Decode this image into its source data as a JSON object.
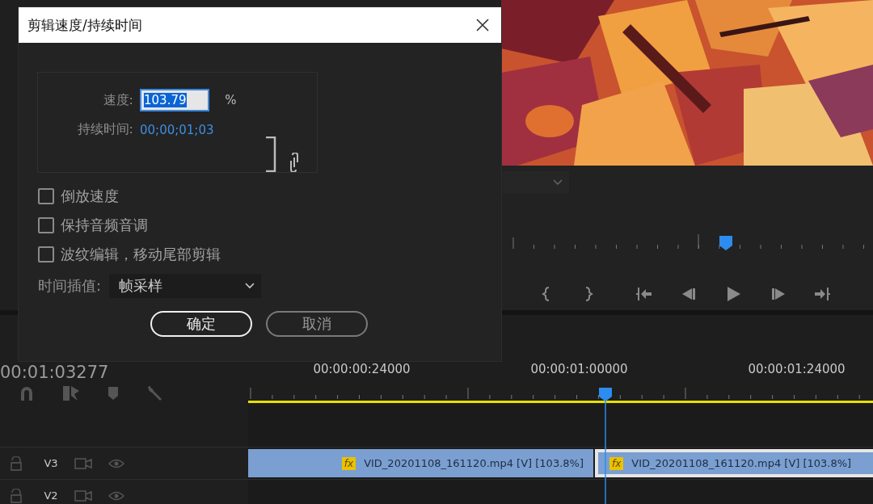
{
  "dialog": {
    "title": "剪辑速度/持续时间",
    "speed": {
      "label": "速度:",
      "value": "103.79",
      "unit": "%"
    },
    "duration": {
      "label": "持续时间:",
      "value": "00;00;01;03"
    },
    "options": [
      {
        "label": "倒放速度",
        "checked": false
      },
      {
        "label": "保持音频音调",
        "checked": false
      },
      {
        "label": "波纹编辑，移动尾部剪辑",
        "checked": false
      }
    ],
    "interpolation": {
      "label": "时间插值:",
      "value": "帧采样"
    },
    "buttons": [
      {
        "label": "确定",
        "focused": true
      },
      {
        "label": "取消",
        "focused": false
      }
    ]
  },
  "timeline": {
    "timecode": "00:01:03277",
    "ruler_labels": [
      "00:00:00:24000",
      "00:00:01:00000",
      "00:00:01:24000"
    ],
    "tracks": [
      {
        "name": "V3",
        "clips": [
          {
            "fx": "fx",
            "name": "VID_20201108_161120.mp4 [V] [103.8%]",
            "selected": false
          },
          {
            "fx": "fx",
            "name": "VID_20201108_161120.mp4 [V] [103.8%]",
            "selected": true
          }
        ]
      },
      {
        "name": "V2"
      }
    ]
  }
}
